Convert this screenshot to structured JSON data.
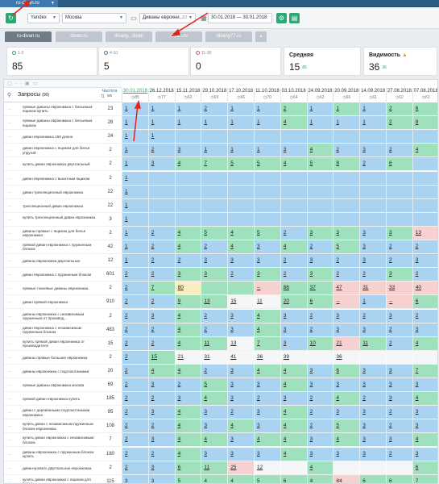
{
  "project": {
    "name": "ru-divan.ru"
  },
  "toolbar": {
    "engine": "Yandex",
    "region": "Москва",
    "group": "Диваны еврокни...",
    "group_count": "53",
    "date_range": "30.01.2018 — 30.01.2018"
  },
  "sites": [
    "ru-divan.ru",
    "divan.ru",
    "divany...divan",
    "divan.ru",
    "divany77.ru"
  ],
  "cards": [
    {
      "label": "1-3",
      "value": "85",
      "dot": "#2aa876"
    },
    {
      "label": "4-10",
      "value": "5",
      "dot": "#3d7ab0"
    },
    {
      "label": "11-30",
      "value": "0",
      "dot": "#e05555"
    },
    {
      "title": "Средняя",
      "value": "15",
      "sub": "85"
    },
    {
      "title": "Видимость",
      "value": "36",
      "sub": "36"
    }
  ],
  "table": {
    "query_label": "Запросы",
    "query_count": "(90)",
    "freq_label": "Частота",
    "freq_sub": "ws",
    "dates": [
      "30.01.2018",
      "26.12.2018",
      "15.11.2018",
      "29.10.2018",
      "17.10.2018",
      "11.10.2018",
      "03.10.2018",
      "24.09.2018",
      "20.09.2018",
      "14.09.2018",
      "27.08.2018",
      "07.08.2018"
    ],
    "date_subs": [
      "85",
      "77",
      "62",
      "69",
      "66",
      "70",
      "64",
      "62",
      "66",
      "61",
      "62",
      "61"
    ],
    "rows": [
      {
        "kw": "прямые диваны еврокнижка с бельевым ящиком купить",
        "fr": "23",
        "v": [
          "1",
          "1",
          "1",
          "2",
          "1",
          "1",
          "2",
          "1",
          "1",
          "1",
          "2",
          "6"
        ],
        "c": [
          "b",
          "b",
          "b",
          "b",
          "b",
          "b",
          "g",
          "b",
          "g",
          "b",
          "g",
          "g"
        ]
      },
      {
        "kw": "прямые диваны еврокнижка с бельевым ящиком",
        "fr": "28",
        "v": [
          "1",
          "1",
          "1",
          "1",
          "1",
          "1",
          "4",
          "1",
          "1",
          "1",
          "2",
          "8"
        ],
        "c": [
          "b",
          "b",
          "b",
          "b",
          "b",
          "b",
          "g",
          "b",
          "b",
          "b",
          "g",
          "g"
        ]
      },
      {
        "kw": "диван еврокнижка 150 длина",
        "fr": "24",
        "v": [
          "1",
          "1",
          "",
          "",
          "",
          "",
          "",
          "",
          "",
          "",
          "",
          ""
        ],
        "c": [
          "b",
          "b",
          "b",
          "b",
          "b",
          "b",
          "b",
          "b",
          "b",
          "b",
          "b",
          "b"
        ]
      },
      {
        "kw": "диван еврокнижка с ящиком для белья упругий",
        "fr": "2",
        "v": [
          "1",
          "2",
          "3",
          "1",
          "1",
          "1",
          "3",
          "4",
          "2",
          "3",
          "2",
          "4"
        ],
        "c": [
          "b",
          "b",
          "b",
          "b",
          "b",
          "b",
          "b",
          "g",
          "b",
          "b",
          "b",
          "g"
        ]
      },
      {
        "kw": "купить диван еврокнижка двуспальный",
        "fr": "2",
        "v": [
          "1",
          "3",
          "4",
          "7",
          "5",
          "5",
          "4",
          "5",
          "8",
          "2",
          "6",
          ""
        ],
        "c": [
          "b",
          "b",
          "g",
          "g",
          "g",
          "g",
          "g",
          "g",
          "g",
          "b",
          "g",
          "b"
        ]
      },
      {
        "kw": "диван еврокнижка с выкатным ящиком",
        "fr": "2",
        "v": [
          "1",
          "",
          "",
          "",
          "",
          "",
          "",
          "",
          "",
          "",
          "",
          ""
        ],
        "c": [
          "b",
          "b",
          "b",
          "b",
          "b",
          "b",
          "b",
          "b",
          "b",
          "b",
          "b",
          "b"
        ]
      },
      {
        "kw": "диван трехсекционный еврокнижка",
        "fr": "22",
        "v": [
          "1",
          "",
          "",
          "",
          "",
          "",
          "",
          "",
          "",
          "",
          "",
          ""
        ],
        "c": [
          "b",
          "b",
          "b",
          "b",
          "b",
          "b",
          "b",
          "b",
          "b",
          "b",
          "b",
          "b"
        ]
      },
      {
        "kw": "трехсекционный диван еврокнижка",
        "fr": "22",
        "v": [
          "1",
          "",
          "",
          "",
          "",
          "",
          "",
          "",
          "",
          "",
          "",
          ""
        ],
        "c": [
          "b",
          "b",
          "b",
          "b",
          "b",
          "b",
          "b",
          "b",
          "b",
          "b",
          "b",
          "b"
        ]
      },
      {
        "kw": "купить трехсекционный диван еврокнижка",
        "fr": "3",
        "v": [
          "1",
          "",
          "",
          "",
          "",
          "",
          "",
          "",
          "",
          "",
          "",
          ""
        ],
        "c": [
          "b",
          "b",
          "b",
          "b",
          "b",
          "b",
          "b",
          "b",
          "b",
          "b",
          "b",
          "b"
        ]
      },
      {
        "kw": "диваны прямые с ящиком для белья еврокнижка",
        "fr": "2",
        "v": [
          "1",
          "2",
          "4",
          "5",
          "4",
          "5",
          "2",
          "3",
          "3",
          "3",
          "3",
          "13"
        ],
        "c": [
          "b",
          "b",
          "g",
          "g",
          "g",
          "g",
          "b",
          "g",
          "g",
          "b",
          "g",
          "r"
        ]
      },
      {
        "kw": "прямой диван еврокнижка с пружинным блоком",
        "fr": "42",
        "v": [
          "1",
          "2",
          "4",
          "2",
          "4",
          "3",
          "4",
          "2",
          "5",
          "3",
          "2",
          "2"
        ],
        "c": [
          "b",
          "b",
          "g",
          "b",
          "g",
          "b",
          "g",
          "b",
          "g",
          "b",
          "b",
          "b"
        ]
      },
      {
        "kw": "диваны еврокнижка двуспальные",
        "fr": "12",
        "v": [
          "1",
          "2",
          "2",
          "3",
          "3",
          "3",
          "2",
          "3",
          "2",
          "3",
          "2",
          "3"
        ],
        "c": [
          "b",
          "b",
          "b",
          "b",
          "b",
          "b",
          "b",
          "b",
          "b",
          "b",
          "b",
          "b"
        ]
      },
      {
        "kw": "диван еврокнижка с пружинным блоком",
        "fr": "601",
        "v": [
          "2",
          "2",
          "3",
          "3",
          "2",
          "3",
          "2",
          "3",
          "2",
          "2",
          "3",
          "2"
        ],
        "c": [
          "b",
          "b",
          "g",
          "g",
          "b",
          "g",
          "b",
          "g",
          "b",
          "b",
          "g",
          "b"
        ]
      },
      {
        "kw": "прямые тканевые диваны еврокнижка",
        "fr": "2",
        "v": [
          "2",
          "7",
          "80",
          "",
          "",
          "--",
          "86",
          "37",
          "47",
          "31",
          "33",
          "40"
        ],
        "c": [
          "b",
          "g",
          "y",
          "g",
          "g",
          "r",
          "g",
          "g",
          "r",
          "r",
          "r",
          "r"
        ]
      },
      {
        "kw": "диван прямой еврокнижка",
        "fr": "910",
        "v": [
          "2",
          "2",
          "9",
          "13",
          "15",
          "11",
          "20",
          "6",
          "--",
          "1",
          "--",
          "6"
        ],
        "c": [
          "b",
          "b",
          "g",
          "g",
          "w",
          "w",
          "g",
          "g",
          "r",
          "b",
          "r",
          "g"
        ]
      },
      {
        "kw": "диваны еврокнижка с независимым пружинным от производ...",
        "fr": "2",
        "v": [
          "2",
          "3",
          "4",
          "2",
          "3",
          "4",
          "3",
          "2",
          "3",
          "2",
          "3",
          "2"
        ],
        "c": [
          "b",
          "b",
          "g",
          "b",
          "b",
          "g",
          "b",
          "b",
          "b",
          "b",
          "b",
          "b"
        ]
      },
      {
        "kw": "диван еврокнижка с независимым пружинным блоком",
        "fr": "483",
        "v": [
          "2",
          "2",
          "4",
          "2",
          "3",
          "4",
          "3",
          "2",
          "3",
          "3",
          "2",
          "3"
        ],
        "c": [
          "b",
          "b",
          "g",
          "b",
          "b",
          "g",
          "b",
          "b",
          "b",
          "b",
          "b",
          "b"
        ]
      },
      {
        "kw": "купить прямой диван еврокнижка от производителя",
        "fr": "15",
        "v": [
          "2",
          "2",
          "4",
          "11",
          "13",
          "7",
          "3",
          "10",
          "21",
          "11",
          "2",
          "4"
        ],
        "c": [
          "b",
          "b",
          "g",
          "g",
          "w",
          "g",
          "b",
          "g",
          "r",
          "g",
          "b",
          "g"
        ]
      },
      {
        "kw": "диваны прямые большие еврокнижка",
        "fr": "2",
        "v": [
          "2",
          "15",
          "21",
          "31",
          "41",
          "36",
          "39",
          "",
          "36",
          "",
          "",
          ""
        ],
        "c": [
          "b",
          "g",
          "w",
          "w",
          "w",
          "w",
          "w",
          "w",
          "w",
          "w",
          "w",
          "w"
        ]
      },
      {
        "kw": "диваны еврокнижка с подлокотниками",
        "fr": "20",
        "v": [
          "2",
          "4",
          "4",
          "2",
          "3",
          "4",
          "4",
          "3",
          "6",
          "3",
          "3",
          "7"
        ],
        "c": [
          "b",
          "g",
          "g",
          "b",
          "b",
          "g",
          "g",
          "b",
          "g",
          "b",
          "b",
          "g"
        ]
      },
      {
        "kw": "прямые диваны еврокнижка москва",
        "fr": "69",
        "v": [
          "2",
          "3",
          "2",
          "5",
          "3",
          "3",
          "4",
          "3",
          "3",
          "3",
          "3",
          "3"
        ],
        "c": [
          "b",
          "b",
          "b",
          "g",
          "b",
          "b",
          "g",
          "b",
          "b",
          "b",
          "b",
          "b"
        ]
      },
      {
        "kw": "прямой диван еврокнижка купить",
        "fr": "185",
        "v": [
          "2",
          "2",
          "3",
          "4",
          "3",
          "2",
          "3",
          "2",
          "4",
          "2",
          "3",
          "4"
        ],
        "c": [
          "b",
          "b",
          "b",
          "g",
          "b",
          "b",
          "b",
          "b",
          "g",
          "b",
          "b",
          "g"
        ]
      },
      {
        "kw": "диван с деревянными подлокотниками еврокнижка",
        "fr": "95",
        "v": [
          "2",
          "3",
          "4",
          "3",
          "2",
          "3",
          "4",
          "2",
          "3",
          "3",
          "2",
          "3"
        ],
        "c": [
          "b",
          "b",
          "g",
          "b",
          "b",
          "b",
          "g",
          "b",
          "b",
          "b",
          "b",
          "b"
        ]
      },
      {
        "kw": "купить диван с независимым пружинным блоком еврокнижка",
        "fr": "108",
        "v": [
          "2",
          "2",
          "4",
          "3",
          "4",
          "3",
          "4",
          "2",
          "5",
          "3",
          "2",
          "3"
        ],
        "c": [
          "b",
          "b",
          "g",
          "b",
          "g",
          "b",
          "g",
          "b",
          "g",
          "b",
          "b",
          "b"
        ]
      },
      {
        "kw": "купить диван еврокнижка с независимым блоком",
        "fr": "7",
        "v": [
          "2",
          "3",
          "4",
          "4",
          "3",
          "4",
          "4",
          "3",
          "4",
          "3",
          "3",
          "4"
        ],
        "c": [
          "b",
          "b",
          "g",
          "g",
          "b",
          "g",
          "g",
          "b",
          "g",
          "b",
          "b",
          "g"
        ]
      },
      {
        "kw": "диваны еврокнижка с пружинным блоком купить",
        "fr": "180",
        "v": [
          "2",
          "2",
          "4",
          "3",
          "3",
          "3",
          "4",
          "3",
          "3",
          "3",
          "2",
          "3"
        ],
        "c": [
          "b",
          "b",
          "g",
          "b",
          "b",
          "b",
          "g",
          "b",
          "b",
          "b",
          "b",
          "b"
        ]
      },
      {
        "kw": "диван-кровать двуспальная еврокнижка",
        "fr": "2",
        "v": [
          "2",
          "3",
          "6",
          "11",
          "25",
          "12",
          "",
          "4",
          "",
          "",
          "",
          "6"
        ],
        "c": [
          "b",
          "b",
          "g",
          "g",
          "r",
          "w",
          "w",
          "g",
          "w",
          "w",
          "w",
          "g"
        ]
      },
      {
        "kw": "купить диван еврокнижка с ящиком для белья",
        "fr": "115",
        "v": [
          "3",
          "3",
          "5",
          "4",
          "4",
          "5",
          "6",
          "4",
          "84",
          "6",
          "6",
          "7"
        ],
        "c": [
          "b",
          "b",
          "g",
          "g",
          "g",
          "g",
          "g",
          "g",
          "r",
          "g",
          "g",
          "g"
        ]
      }
    ]
  }
}
